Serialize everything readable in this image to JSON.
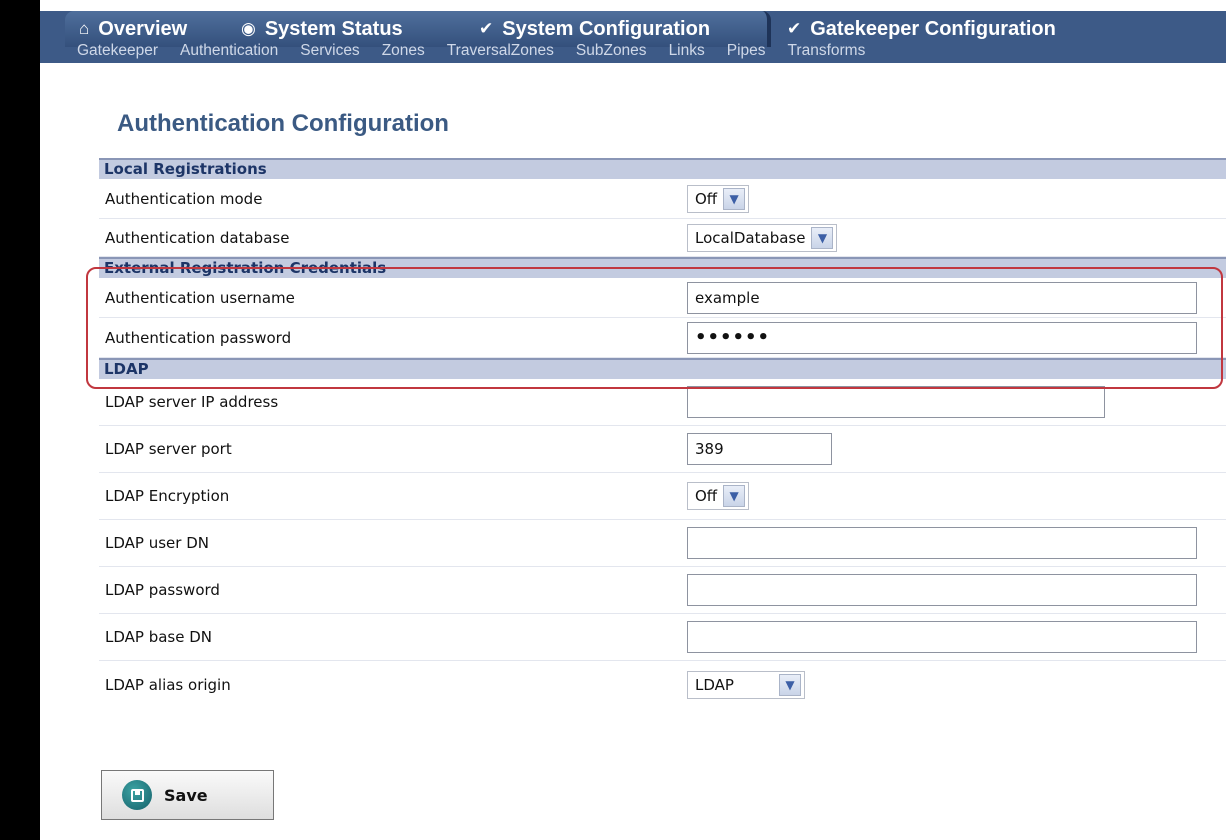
{
  "tabs": [
    {
      "icon": "home-icon",
      "glyph": "⌂",
      "label": "Overview",
      "active": false
    },
    {
      "icon": "status-icon",
      "glyph": "◉",
      "label": "System Status",
      "active": false
    },
    {
      "icon": "wrench-icon",
      "glyph": "✔",
      "label": "System Configuration",
      "active": false
    },
    {
      "icon": "wrench-icon",
      "glyph": "✔",
      "label": "Gatekeeper Configuration",
      "active": true
    }
  ],
  "subnav": [
    "Gatekeeper",
    "Authentication",
    "Services",
    "Zones",
    "TraversalZones",
    "SubZones",
    "Links",
    "Pipes",
    "Transforms"
  ],
  "page_title": "Authentication Configuration",
  "sections": {
    "local": {
      "title": "Local Registrations",
      "auth_mode": {
        "label": "Authentication mode",
        "value": "Off"
      },
      "auth_db": {
        "label": "Authentication database",
        "value": "LocalDatabase"
      }
    },
    "external": {
      "title": "External Registration Credentials",
      "username": {
        "label": "Authentication username",
        "value": "example"
      },
      "password": {
        "label": "Authentication password",
        "value": "••••••"
      }
    },
    "ldap": {
      "title": "LDAP",
      "server_ip": {
        "label": "LDAP server IP address",
        "value": ""
      },
      "server_port": {
        "label": "LDAP server port",
        "value": "389"
      },
      "encryption": {
        "label": "LDAP Encryption",
        "value": "Off"
      },
      "user_dn": {
        "label": "LDAP user DN",
        "value": ""
      },
      "password": {
        "label": "LDAP password",
        "value": ""
      },
      "base_dn": {
        "label": "LDAP base DN",
        "value": ""
      },
      "alias_origin": {
        "label": "LDAP alias origin",
        "value": "LDAP"
      }
    }
  },
  "save_label": "Save",
  "colors": {
    "tabbar": "#3d5a87",
    "section_header": "#c3cbe0",
    "title": "#3b5a83",
    "highlight": "#c1373f"
  }
}
